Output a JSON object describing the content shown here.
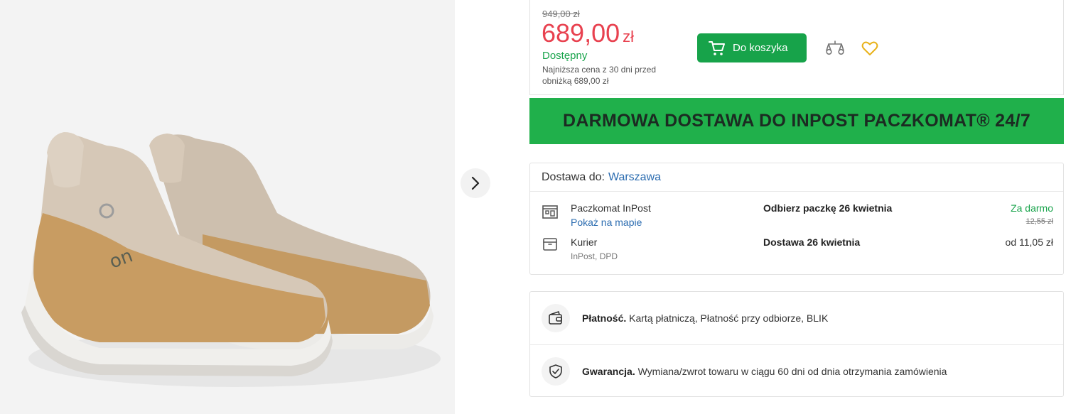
{
  "product": {
    "image_alt": "On Cloud Hi shoes"
  },
  "gallery": {
    "next_icon": "chevron-right-icon"
  },
  "pricing": {
    "old_price": "949,00 zł",
    "price": "689,00",
    "currency": "zł",
    "availability": "Dostępny",
    "lowest_price_note": "Najniższa cena z 30 dni przed obniżką 689,00 zł",
    "add_to_cart": "Do koszyka",
    "accent_color": "#e8414f",
    "brand_green": "#17a34a"
  },
  "banner": {
    "text": "DARMOWA DOSTAWA DO INPOST PACZKOMAT® 24/7",
    "color": "#20b04b"
  },
  "delivery": {
    "label": "Dostawa do:",
    "city": "Warszawa",
    "options": [
      {
        "icon": "parcel-locker-icon",
        "name": "Paczkomat InPost",
        "link": "Pokaż na mapie",
        "when": "Odbierz paczkę 26 kwietnia",
        "cost": "Za darmo",
        "old_cost": "12,55 zł"
      },
      {
        "icon": "courier-box-icon",
        "name": "Kurier",
        "sub": "InPost, DPD",
        "when": "Dostawa 26 kwietnia",
        "cost": "od 11,05 zł"
      }
    ]
  },
  "info": {
    "payment": {
      "icon": "wallet-icon",
      "label": "Płatność.",
      "text": " Kartą płatniczą, Płatność przy odbiorze, BLIK"
    },
    "warranty": {
      "icon": "shield-check-icon",
      "label": "Gwarancja.",
      "text": " Wymiana/zwrot towaru w ciągu 60 dni od dnia otrzymania zamówienia"
    }
  }
}
